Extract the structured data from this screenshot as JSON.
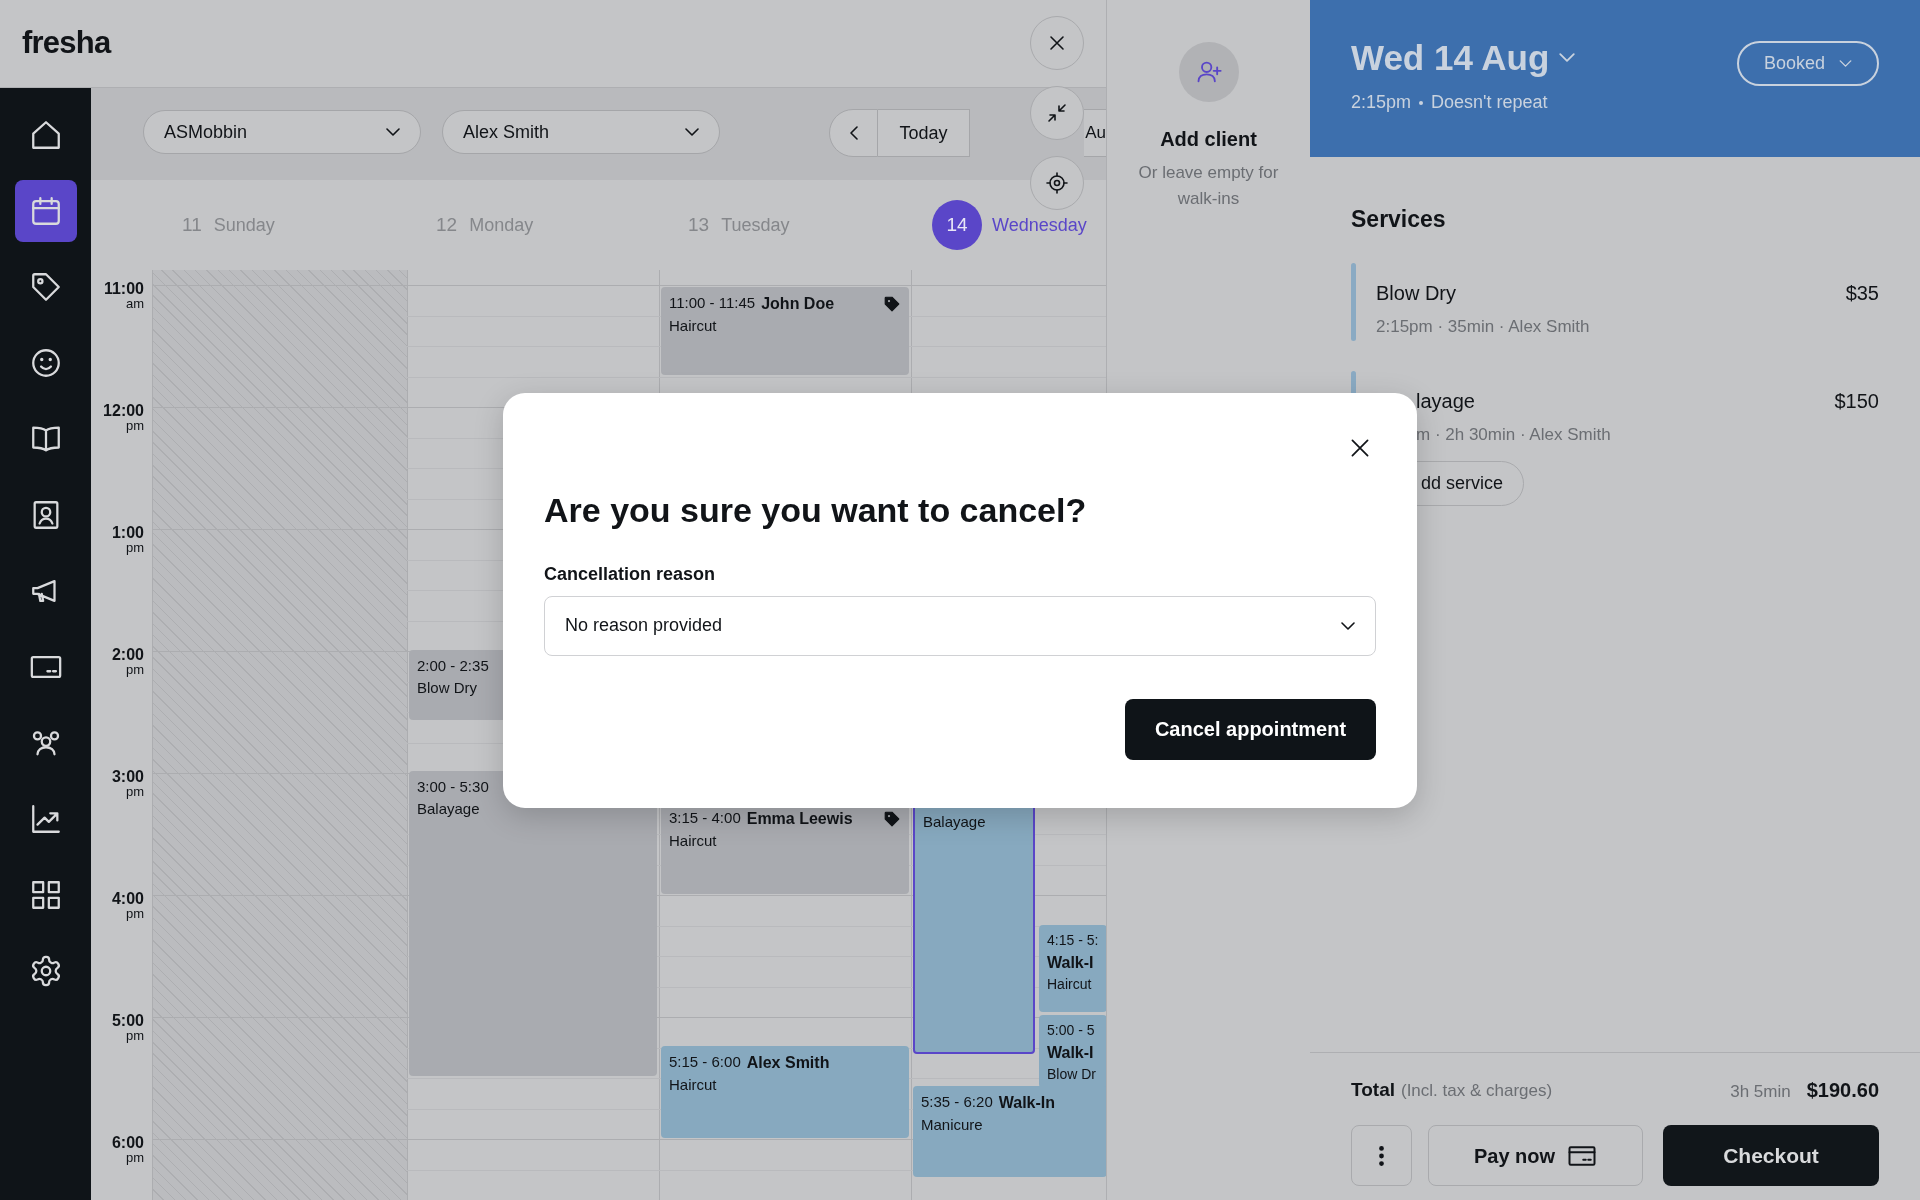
{
  "logo": "fresha",
  "sidebar": [
    {
      "selected": false
    },
    {
      "selected": true
    },
    {
      "selected": false
    },
    {
      "selected": false
    },
    {
      "selected": false
    },
    {
      "selected": false
    },
    {
      "selected": false
    },
    {
      "selected": false
    },
    {
      "selected": false
    },
    {
      "selected": false
    },
    {
      "selected": false
    },
    {
      "selected": false
    }
  ],
  "toolbar": {
    "location": "ASMobbin",
    "staff": "Alex Smith",
    "today": "Today",
    "range": "Au"
  },
  "hours": [
    {
      "time": "11:00",
      "period": "am"
    },
    {
      "time": "12:00",
      "period": "pm"
    },
    {
      "time": "1:00",
      "period": "pm"
    },
    {
      "time": "2:00",
      "period": "pm"
    },
    {
      "time": "3:00",
      "period": "pm"
    },
    {
      "time": "4:00",
      "period": "pm"
    },
    {
      "time": "5:00",
      "period": "pm"
    },
    {
      "time": "6:00",
      "period": "pm"
    }
  ],
  "days": [
    {
      "number": "11",
      "name": "Sunday",
      "selected": false,
      "blocked": true
    },
    {
      "number": "12",
      "name": "Monday",
      "selected": false,
      "blocked": false,
      "events": [
        {
          "time": "2:00 - 2:35",
          "service": "Blow Dry",
          "color": "#a9abb0",
          "selected": false
        },
        {
          "time": "3:00 - 5:30",
          "service": "Balayage",
          "color": "#a9abb0",
          "selected": false
        }
      ]
    },
    {
      "number": "13",
      "name": "Tuesday",
      "selected": false,
      "blocked": false,
      "events": [
        {
          "time": "11:00 - 11:45",
          "client": "John Doe",
          "service": "Haircut",
          "color": "#a9abb0",
          "tagged": true,
          "selected": false
        },
        {
          "time": "3:15 - 4:00",
          "client": "Emma Leewis",
          "service": "Haircut",
          "color": "#a9abb0",
          "tagged": true,
          "selected": false
        },
        {
          "time": "5:15 - 6:00",
          "client": "Alex Smith",
          "service": "Haircut",
          "color": "#87a9bf",
          "tagged": false,
          "selected": false
        }
      ]
    },
    {
      "number": "14",
      "name": "Wednesday",
      "selected": true,
      "blocked": false,
      "events": [
        {
          "service": "Balayage",
          "color": "#87a9bf",
          "tagged": false,
          "selected": true
        },
        {
          "time": "4:15 - 5:",
          "client": "Walk-I",
          "service": "Haircut",
          "color": "#87a9bf",
          "tagged": false,
          "selected": false
        },
        {
          "time": "5:00 - 5",
          "client": "Walk-I",
          "service": "Blow Dr",
          "color": "#87a9bf",
          "tagged": false,
          "selected": false
        },
        {
          "time": "5:35 - 6:20",
          "client": "Walk-In",
          "service": "Manicure",
          "color": "#87a9bf",
          "tagged": false,
          "selected": false
        }
      ]
    }
  ],
  "client_panel": {
    "title": "Add client",
    "subtitle": "Or leave empty for walk-ins"
  },
  "appointment": {
    "date": "Wed 14 Aug",
    "time": "2:15pm",
    "repeat": "Doesn't repeat",
    "status": "Booked",
    "services_title": "Services",
    "services": [
      {
        "name": "Blow Dry",
        "details": "2:15pm · 35min · Alex Smith",
        "price": "$35"
      },
      {
        "name": "layage",
        "details": "m · 2h 30min · Alex Smith",
        "price": "$150"
      }
    ],
    "add_service": "dd service",
    "total_label": "Total",
    "total_note": "(Incl. tax & charges)",
    "duration": "3h 5min",
    "total": "$190.60",
    "pay_now": "Pay now",
    "checkout": "Checkout"
  },
  "dialog": {
    "title": "Are you sure you want to cancel?",
    "field_label": "Cancellation reason",
    "value": "No reason provided",
    "confirm": "Cancel appointment"
  }
}
